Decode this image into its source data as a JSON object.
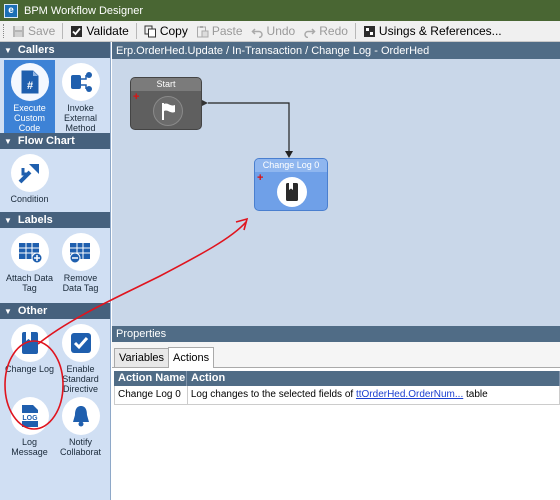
{
  "window": {
    "title": "BPM Workflow Designer",
    "icon_name": "epicor-e-icon"
  },
  "toolbar": {
    "save": "Save",
    "validate": "Validate",
    "copy": "Copy",
    "paste": "Paste",
    "undo": "Undo",
    "redo": "Redo",
    "usages": "Usings & References..."
  },
  "sidebar": {
    "callers": {
      "header": "Callers",
      "items": [
        {
          "label": "Execute Custom Code",
          "icon": "hash-document-icon",
          "selected": true
        },
        {
          "label": "Invoke External Method",
          "icon": "connector-icon",
          "selected": false
        }
      ]
    },
    "flowchart": {
      "header": "Flow Chart",
      "items": [
        {
          "label": "Condition",
          "icon": "branch-arrows-icon"
        }
      ]
    },
    "labels": {
      "header": "Labels",
      "items": [
        {
          "label": "Attach Data Tag",
          "icon": "table-plus-icon"
        },
        {
          "label": "Remove Data Tag",
          "icon": "table-minus-icon"
        }
      ]
    },
    "other": {
      "header": "Other",
      "items": [
        {
          "label": "Change Log",
          "icon": "bookmark-book-icon"
        },
        {
          "label": "Enable Standard Directive",
          "icon": "checkmark-icon"
        },
        {
          "label": "Log Message",
          "icon": "log-document-icon"
        },
        {
          "label": "Notify Collaborat",
          "icon": "bell-icon"
        }
      ]
    }
  },
  "canvas": {
    "header": "Erp.OrderHed.Update / In-Transaction / Change Log - OrderHed",
    "nodes": {
      "start": {
        "title": "Start",
        "icon": "flag-icon"
      },
      "change_log": {
        "title": "Change Log 0",
        "icon": "bookmark-book-icon"
      }
    }
  },
  "properties": {
    "header": "Properties",
    "tabs": [
      "Variables",
      "Actions"
    ],
    "active_tab": "Actions",
    "grid": {
      "columns": [
        "Action Name",
        "Action"
      ],
      "rows": [
        {
          "name": "Change Log 0",
          "action_prefix": "Log changes to the selected fields of ",
          "action_link": "ttOrderHed.OrderNum...",
          "action_suffix": " table"
        }
      ]
    }
  },
  "colors": {
    "titlebar": "#496633",
    "section_header": "#46617d",
    "sidebar_bg": "#d0dff3",
    "canvas_bg": "#c9d7e9",
    "selected_tool": "#3d82d6",
    "annotation_red": "#e0141e"
  }
}
